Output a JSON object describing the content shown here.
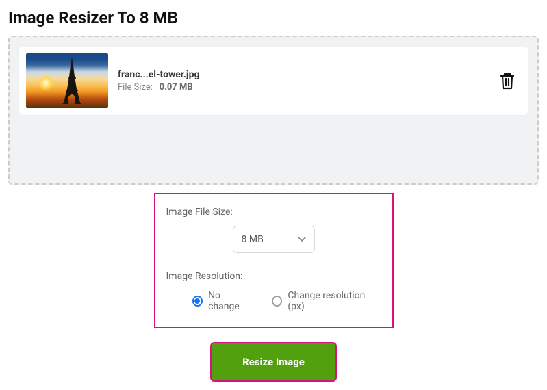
{
  "page": {
    "title": "Image Resizer To 8 MB"
  },
  "file": {
    "name": "franc...el-tower.jpg",
    "size_label": "File Size:",
    "size_value": "0.07 MB"
  },
  "settings": {
    "filesize_label": "Image File Size:",
    "filesize_value": "8 MB",
    "resolution_label": "Image Resolution:",
    "options": {
      "no_change": "No change",
      "change_px": "Change resolution (px)"
    }
  },
  "action": {
    "resize_label": "Resize Image"
  }
}
